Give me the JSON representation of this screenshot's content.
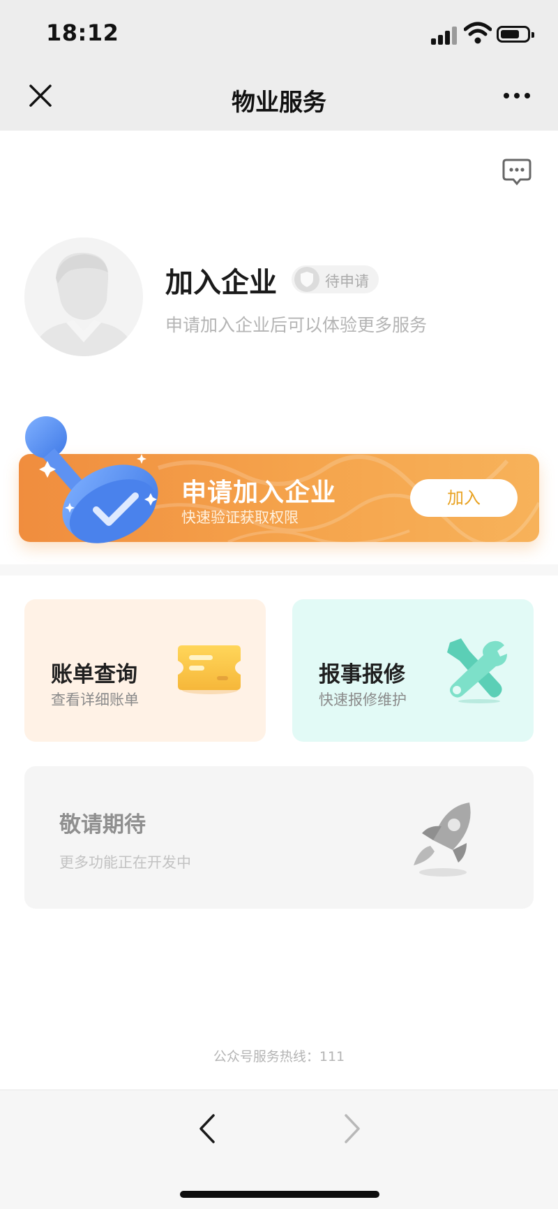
{
  "status_bar": {
    "time": "18:12",
    "icons": [
      "cellular-signal-icon",
      "wifi-icon",
      "battery-icon"
    ]
  },
  "nav": {
    "title": "物业服务",
    "close_icon": "close-icon",
    "more_icon": "more-icon"
  },
  "message_icon": "message-icon",
  "profile": {
    "title": "加入企业",
    "badge": "待申请",
    "subtitle": "申请加入企业后可以体验更多服务"
  },
  "banner": {
    "title": "申请加入企业",
    "subtitle": "快速验证获取权限",
    "button": "加入"
  },
  "services": [
    {
      "title": "账单查询",
      "subtitle": "查看详细账单",
      "icon": "bill-icon"
    },
    {
      "title": "报事报修",
      "subtitle": "快速报修维护",
      "icon": "repair-tools-icon"
    }
  ],
  "coming_soon": {
    "title": "敬请期待",
    "subtitle": "更多功能正在开发中",
    "icon": "rocket-icon"
  },
  "footer": {
    "hotline": "公众号服务热线：111"
  },
  "colors": {
    "banner_orange": "#f08d3e",
    "button_text": "#e8a222",
    "bill_card_bg": "#fff2e6",
    "repair_card_bg": "#e2faf6",
    "soon_card_bg": "#f5f5f5"
  }
}
